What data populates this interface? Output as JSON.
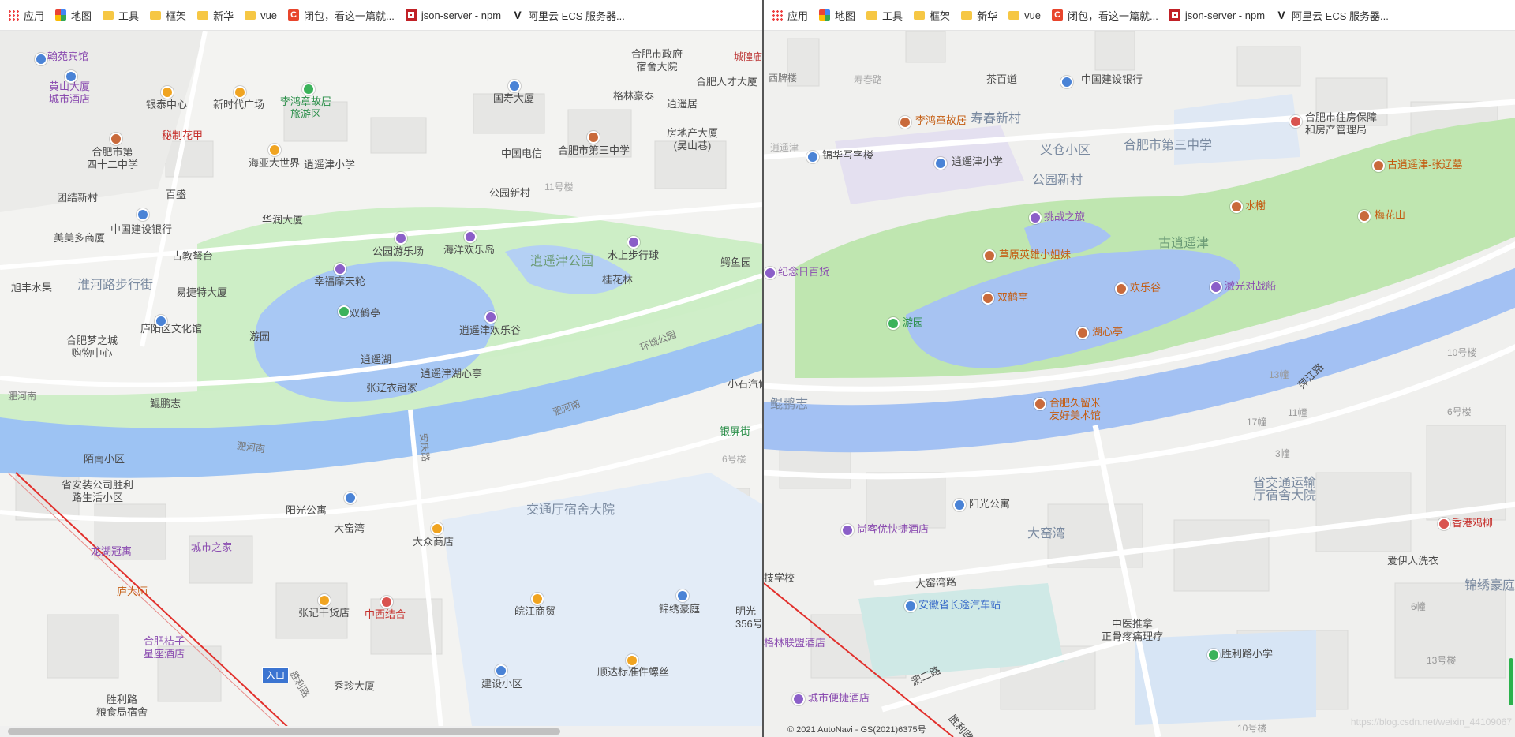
{
  "bookmarks": [
    {
      "label": "应用",
      "icon": "apps-grid-icon"
    },
    {
      "label": "地图",
      "icon": "maps-icon"
    },
    {
      "label": "工具",
      "icon": "folder-icon"
    },
    {
      "label": "框架",
      "icon": "folder-icon"
    },
    {
      "label": "新华",
      "icon": "folder-icon"
    },
    {
      "label": "vue",
      "icon": "folder-icon"
    },
    {
      "label": "闭包，看这一篇就...",
      "icon": "csdn-c-icon"
    },
    {
      "label": "json-server - npm",
      "icon": "npm-icon"
    },
    {
      "label": "阿里云 ECS 服务器...",
      "icon": "v-icon"
    }
  ],
  "left_map": {
    "labels": [
      "翰苑宾馆",
      "黄山大厦\n城市酒店",
      "银泰中心",
      "新时代广场",
      "李鸿章故居\n旅游区",
      "国寿大厦",
      "合肥市政府\n宿舍大院",
      "格林豪泰",
      "合肥人才大厦",
      "逍遥居",
      "房地产大厦\n(吴山巷)",
      "秘制花甲",
      "合肥市第\n四十二中学",
      "海亚大世界",
      "逍遥津小学",
      "中国电信",
      "合肥市第三中学",
      "百盛",
      "团结新村",
      "公园新村",
      "11号楼",
      "华润大厦",
      "中国建设银行",
      "美美多商厦",
      "公园游乐场",
      "海洋欢乐岛",
      "逍遥津公园",
      "水上步行球",
      "古教弩台",
      "鳄鱼园",
      "淮河路步行街",
      "幸福摩天轮",
      "桂花林",
      "旭丰水果",
      "易捷特大厦",
      "双鹤亭",
      "庐阳区文化馆",
      "游园",
      "逍遥津欢乐谷",
      "合肥梦之城\n购物中心",
      "逍遥湖",
      "逍遥津湖心亭",
      "张辽衣冠冢",
      "鲲鹏志",
      "小石汽修",
      "银屏街",
      "陌南小区",
      "6号楼",
      "省安装公司胜利\n路生活小区",
      "阳光公寓",
      "交通厅宿舍大院",
      "大窑湾",
      "大众商店",
      "龙湖冠寓",
      "城市之家",
      "庐大师",
      "锦绣豪庭",
      "张记干货店",
      "中西结合",
      "皖江商贸",
      "明光\n356号",
      "合肥桔子\n星座酒店",
      "入口",
      "秀珍大厦",
      "建设小区",
      "顺达标准件螺丝",
      "胜利路\n粮食局宿舍",
      "淝河南",
      "淝河南",
      "环城公园",
      "淝河南",
      "胜利路",
      "安庆路",
      "城隍庙"
    ]
  },
  "right_map": {
    "labels": [
      "西牌楼",
      "茶百道",
      "中国建设银行",
      "合肥市住房保障\n和房产管理局",
      "李鸿章故居",
      "寿春新村",
      "锦华写字楼",
      "逍遥津小学",
      "义仓小区",
      "合肥市第三中学",
      "公园新村",
      "古逍遥津-张辽墓",
      "水榭",
      "梅花山",
      "挑战之旅",
      "古逍遥津",
      "纪念日百货",
      "草原英雄小姐妹",
      "欢乐谷",
      "激光对战船",
      "双鹤亭",
      "游园",
      "湖心亭",
      "鲲鹏志",
      "合肥久留米\n友好美术馆",
      "10号楼",
      "13幢",
      "11幢",
      "6号楼",
      "17幢",
      "3幢",
      "阳光公寓",
      "省交通运输\n厅宿舍大院",
      "尚客优快捷酒店",
      "大窑湾",
      "香港鸡柳",
      "爱伊人洗衣",
      "锦绣豪庭",
      "技学校",
      "大窑湾路",
      "安徽省长途汽车站",
      "中医推拿\n正骨疼痛理疗",
      "6幢",
      "格林联盟酒店",
      "胜利路小学",
      "13号楼",
      "城市便捷酒店",
      "淝二路",
      "10号楼",
      "胜利路",
      "萍江路",
      "寿春路",
      "逍遥津"
    ],
    "copyright": "© 2021 AutoNavi - GS(2021)6375号",
    "watermark": "https://blog.csdn.net/weixin_44109067"
  }
}
